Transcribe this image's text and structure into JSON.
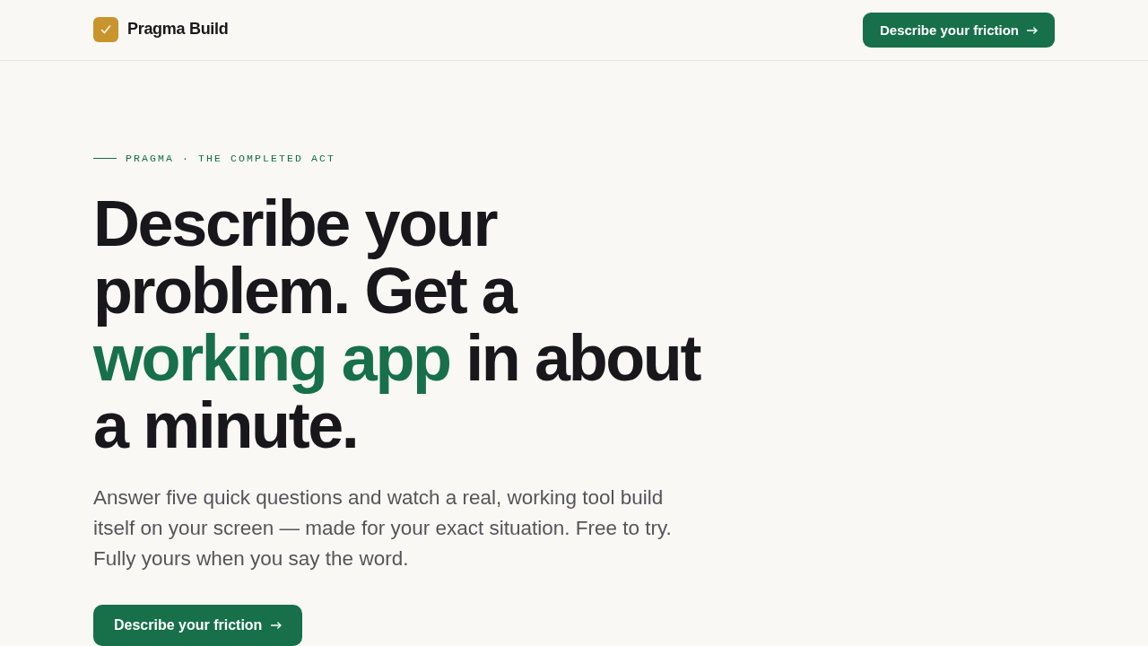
{
  "header": {
    "brand": "Pragma Build",
    "cta": {
      "label": "Describe your friction"
    }
  },
  "hero": {
    "eyebrow": "PRAGMA · THE COMPLETED ACT",
    "headline": [
      {
        "text": "Describe your problem. Get a ",
        "accent": false
      },
      {
        "text": "working app",
        "accent": true
      },
      {
        "text": " in about a minute.",
        "accent": false
      }
    ],
    "lead": "Answer five quick questions and watch a real, working tool build itself on your screen — made for your exact situation. Free to try. Fully yours when you say the word.",
    "cta": {
      "label": "Describe your friction"
    }
  }
}
